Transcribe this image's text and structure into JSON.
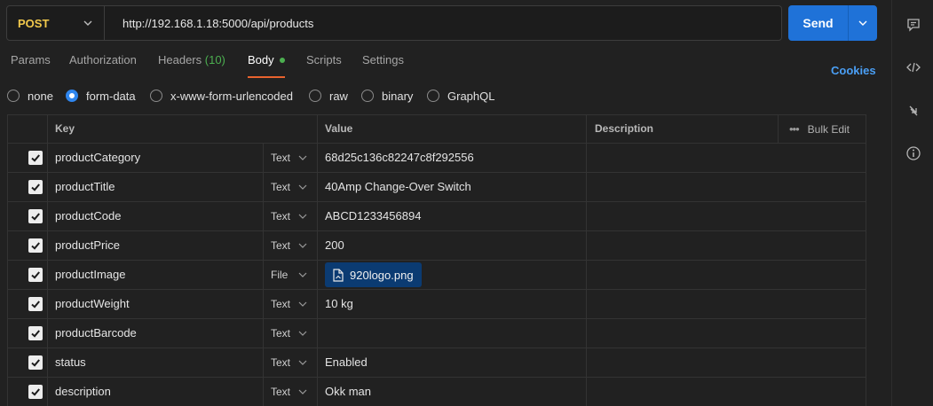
{
  "request": {
    "method": "POST",
    "url": "http://192.168.1.18:5000/api/products",
    "send_label": "Send"
  },
  "tabs": [
    {
      "label": "Params",
      "active": false
    },
    {
      "label": "Authorization",
      "active": false
    },
    {
      "label": "Headers",
      "count": "(10)",
      "active": false
    },
    {
      "label": "Body",
      "active": true
    },
    {
      "label": "Scripts",
      "active": false
    },
    {
      "label": "Settings",
      "active": false
    }
  ],
  "cookies_label": "Cookies",
  "body_types": [
    {
      "label": "none",
      "selected": false
    },
    {
      "label": "form-data",
      "selected": true
    },
    {
      "label": "x-www-form-urlencoded",
      "selected": false
    },
    {
      "label": "raw",
      "selected": false
    },
    {
      "label": "binary",
      "selected": false
    },
    {
      "label": "GraphQL",
      "selected": false
    }
  ],
  "table": {
    "headers": {
      "key": "Key",
      "value": "Value",
      "description": "Description",
      "bulk_edit": "Bulk Edit"
    },
    "rows": [
      {
        "key": "productCategory",
        "type": "Text",
        "value": "68d25c136c82247c8f292556",
        "checked": true
      },
      {
        "key": "productTitle",
        "type": "Text",
        "value": "40Amp Change-Over Switch",
        "checked": true
      },
      {
        "key": "productCode",
        "type": "Text",
        "value": "ABCD1233456894",
        "checked": true
      },
      {
        "key": "productPrice",
        "type": "Text",
        "value": "200",
        "checked": true
      },
      {
        "key": "productImage",
        "type": "File",
        "value": "920logo.png",
        "checked": true
      },
      {
        "key": "productWeight",
        "type": "Text",
        "value": "10 kg",
        "checked": true
      },
      {
        "key": "productBarcode",
        "type": "Text",
        "value": "",
        "checked": true
      },
      {
        "key": "status",
        "type": "Text",
        "value": "Enabled",
        "checked": true
      },
      {
        "key": "description",
        "type": "Text",
        "value": "Okk man",
        "checked": true
      }
    ]
  },
  "rail_icons": [
    "comment-icon",
    "code-icon",
    "arrows-icon",
    "info-icon"
  ],
  "colors": {
    "accent": "#1f72d8",
    "method": "#f2c94c",
    "active_tab": "#e9622e",
    "count": "#4caf50",
    "link": "#4a9ff5"
  }
}
